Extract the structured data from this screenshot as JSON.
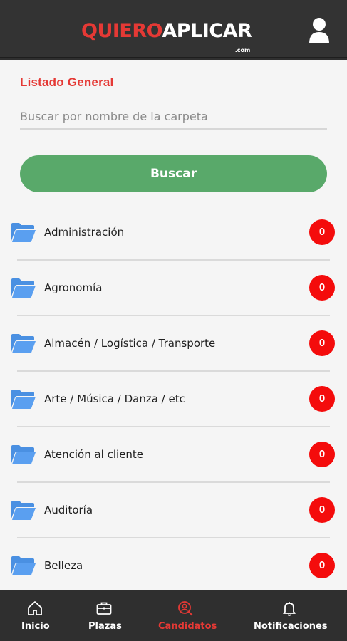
{
  "header": {
    "logo_part1": "QUIERO",
    "logo_part2": "APLICAR",
    "logo_suffix": ".com",
    "user_icon": "user-icon"
  },
  "main": {
    "section_title": "Listado General",
    "search_placeholder": "Buscar por nombre de la carpeta",
    "search_value": "",
    "search_button_label": "Buscar"
  },
  "folders": [
    {
      "label": "Administración",
      "count": "0"
    },
    {
      "label": "Agronomía",
      "count": "0"
    },
    {
      "label": "Almacén / Logística / Transporte",
      "count": "0"
    },
    {
      "label": "Arte / Música / Danza / etc",
      "count": "0"
    },
    {
      "label": "Atención al cliente",
      "count": "0"
    },
    {
      "label": "Auditoría",
      "count": "0"
    },
    {
      "label": "Belleza",
      "count": "0"
    }
  ],
  "bottom_nav": [
    {
      "label": "Inicio",
      "icon": "home-icon",
      "active": false
    },
    {
      "label": "Plazas",
      "icon": "briefcase-icon",
      "active": false
    },
    {
      "label": "Candidatos",
      "icon": "candidates-search-icon",
      "active": true
    },
    {
      "label": "Notificaciones",
      "icon": "bell-icon",
      "active": false
    }
  ],
  "colors": {
    "brand_red": "#e53935",
    "button_green": "#59a96a",
    "badge_red": "#f40c0c",
    "folder_blue": "#4a90e2",
    "header_bg": "#333333"
  }
}
